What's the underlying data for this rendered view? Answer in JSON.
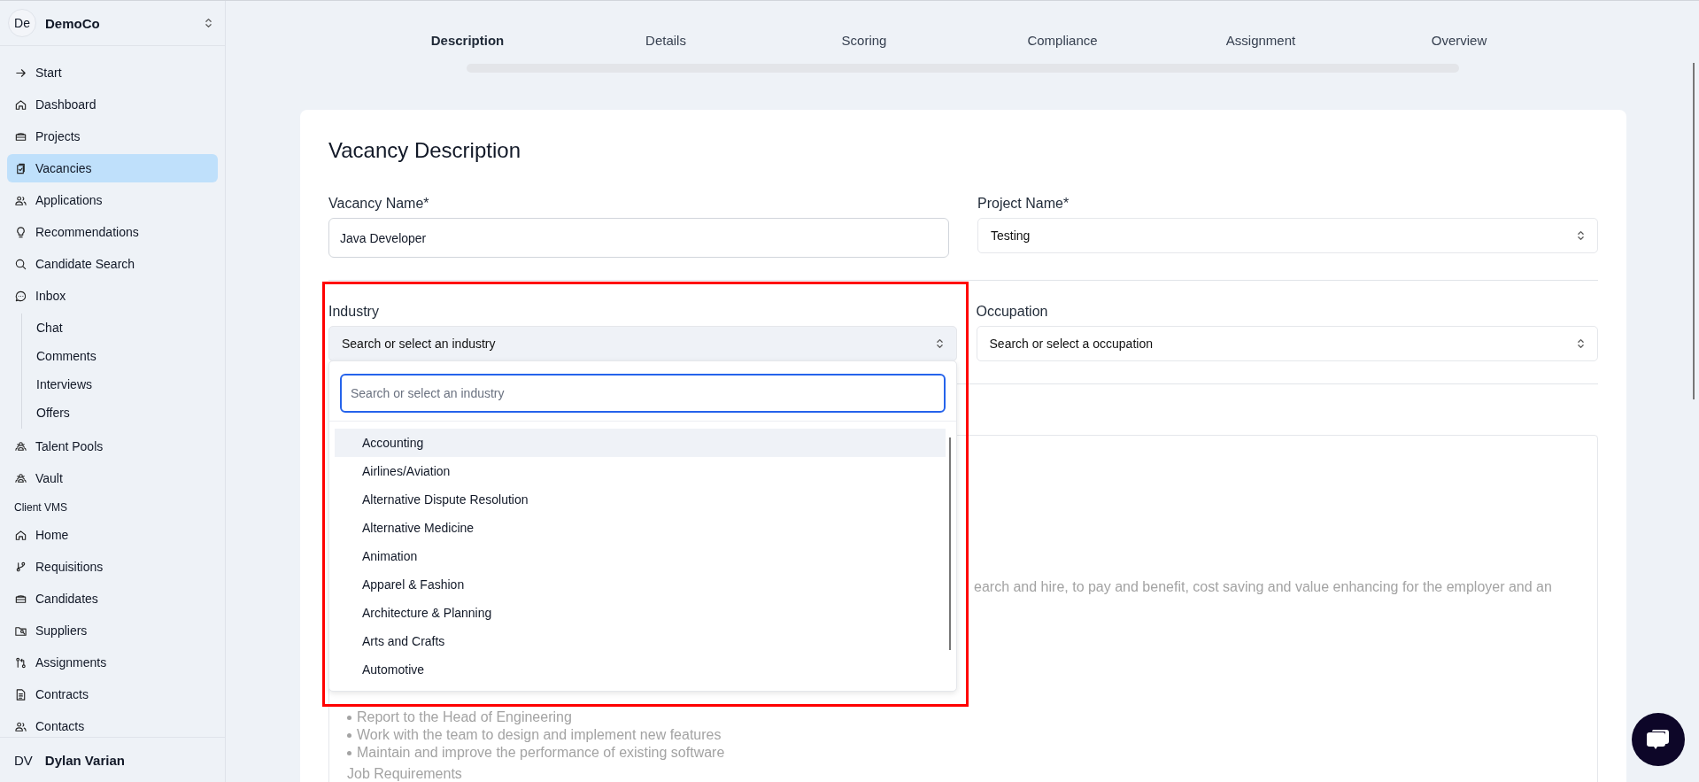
{
  "sidebar": {
    "workspace": {
      "avatar": "De",
      "name": "DemoCo"
    },
    "items": [
      {
        "kind": "link",
        "label": "Start",
        "selected": false
      },
      {
        "kind": "link",
        "label": "Dashboard",
        "selected": false
      },
      {
        "kind": "link",
        "label": "Projects",
        "selected": false
      },
      {
        "kind": "link",
        "label": "Vacancies",
        "selected": true
      },
      {
        "kind": "link",
        "label": "Applications",
        "selected": false
      },
      {
        "kind": "link",
        "label": "Recommendations",
        "selected": false
      },
      {
        "kind": "link",
        "label": "Candidate Search",
        "selected": false
      },
      {
        "kind": "link",
        "label": "Inbox",
        "selected": false,
        "children": [
          {
            "label": "Chat",
            "selected": false
          },
          {
            "label": "Comments",
            "selected": false
          },
          {
            "label": "Interviews",
            "selected": false
          },
          {
            "label": "Offers",
            "selected": false
          }
        ]
      },
      {
        "kind": "link",
        "label": "Talent Pools",
        "selected": false
      },
      {
        "kind": "link",
        "label": "Vault",
        "selected": false
      },
      {
        "kind": "section",
        "label": "Client VMS"
      },
      {
        "kind": "link",
        "label": "Home",
        "selected": false
      },
      {
        "kind": "link",
        "label": "Requisitions",
        "selected": false
      },
      {
        "kind": "link",
        "label": "Candidates",
        "selected": false
      },
      {
        "kind": "link",
        "label": "Suppliers",
        "selected": false
      },
      {
        "kind": "link",
        "label": "Assignments",
        "selected": false
      },
      {
        "kind": "link",
        "label": "Contracts",
        "selected": false
      },
      {
        "kind": "link",
        "label": "Contacts",
        "selected": false
      }
    ],
    "user": {
      "initials": "DV",
      "name": "Dylan Varian"
    }
  },
  "steps": [
    {
      "label": "Description",
      "selected": true
    },
    {
      "label": "Details",
      "selected": false
    },
    {
      "label": "Scoring",
      "selected": false
    },
    {
      "label": "Compliance",
      "selected": false
    },
    {
      "label": "Assignment",
      "selected": false
    },
    {
      "label": "Overview",
      "selected": false
    }
  ],
  "form": {
    "title": "Vacancy Description",
    "vacancy_name": {
      "label": "Vacancy Name*",
      "value": "Java Developer"
    },
    "project_name": {
      "label": "Project Name*",
      "value": "Testing"
    },
    "industry": {
      "label": "Industry",
      "value": "Search or select an industry",
      "expanded": true,
      "search": {
        "placeholder": "Search or select an industry"
      },
      "options": [
        {
          "label": "Accounting",
          "selected": true
        },
        {
          "label": "Airlines/Aviation",
          "selected": false
        },
        {
          "label": "Alternative Dispute Resolution",
          "selected": false
        },
        {
          "label": "Alternative Medicine",
          "selected": false
        },
        {
          "label": "Animation",
          "selected": false
        },
        {
          "label": "Apparel & Fashion",
          "selected": false
        },
        {
          "label": "Architecture & Planning",
          "selected": false
        },
        {
          "label": "Arts and Crafts",
          "selected": false
        },
        {
          "label": "Automotive",
          "selected": false
        }
      ]
    },
    "occupation": {
      "label": "Occupation",
      "value": "Search or select a occupation"
    },
    "description_lines": [
      {
        "kind": "partial",
        "text": "earch and hire, to pay and benefit, cost saving and value enhancing for the employer and an"
      },
      {
        "kind": "bullet",
        "text": "Report to the Head of Engineering"
      },
      {
        "kind": "bullet",
        "text": "Work with the team to design and implement new features"
      },
      {
        "kind": "bullet",
        "text": "Maintain and improve the performance of existing software"
      },
      {
        "kind": "heading",
        "text": "Job Requirements"
      }
    ]
  }
}
